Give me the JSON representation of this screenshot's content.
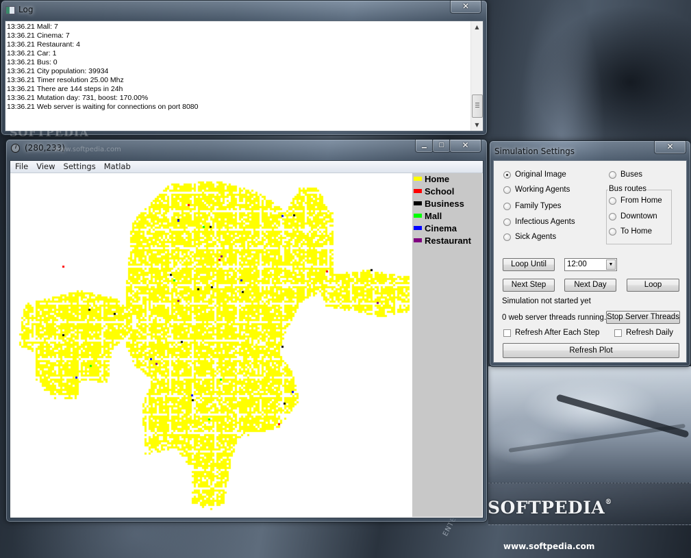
{
  "desktop": {
    "brand": "SOFTPEDIA",
    "brand_mark": "®",
    "url": "www.softpedia.com",
    "overlay_text": "ENTER",
    "watermark": "SOFTPEDIA",
    "watermark_url": "www.softpedia.com"
  },
  "log_window": {
    "title": "Log",
    "close_label": "✕",
    "lines": [
      {
        "time": "13:36.21",
        "text": "Mall: 7"
      },
      {
        "time": "13:36.21",
        "text": "Cinema: 7"
      },
      {
        "time": "13:36.21",
        "text": "Restaurant: 4"
      },
      {
        "time": "13:36.21",
        "text": "Car: 1"
      },
      {
        "time": "13:36.21",
        "text": "Bus: 0"
      },
      {
        "time": "13:36.21",
        "text": "City population: 39934"
      },
      {
        "time": "13:36.21",
        "text": "Timer resolution 25.00 Mhz"
      },
      {
        "time": "13:36.21",
        "text": "There are 144 steps in 24h"
      },
      {
        "time": "13:36.21",
        "text": "Mutation day: 731, boost: 170.00%"
      },
      {
        "time": "13:36.21",
        "text": "Web server is waiting for connections on port 8080"
      }
    ],
    "scroll_up": "▲",
    "scroll_down": "▼"
  },
  "map_window": {
    "title": "(280,233)",
    "minimize_label": "▁",
    "maximize_label": "▢",
    "close_label": "✕",
    "menu": [
      "File",
      "View",
      "Settings",
      "Matlab"
    ],
    "legend": [
      {
        "label": "Home",
        "color": "#ffff00"
      },
      {
        "label": "School",
        "color": "#ff0000"
      },
      {
        "label": "Business",
        "color": "#000000"
      },
      {
        "label": "Mall",
        "color": "#00ff00"
      },
      {
        "label": "Cinema",
        "color": "#0000ff"
      },
      {
        "label": "Restaurant",
        "color": "#800080"
      }
    ]
  },
  "settings_window": {
    "title": "Simulation Settings",
    "close_label": "✕",
    "view_options": [
      {
        "label": "Original Image",
        "checked": true
      },
      {
        "label": "Working Agents",
        "checked": false
      },
      {
        "label": "Family Types",
        "checked": false
      },
      {
        "label": "Infectious Agents",
        "checked": false
      },
      {
        "label": "Sick Agents",
        "checked": false
      }
    ],
    "buses_option": {
      "label": "Buses",
      "checked": false
    },
    "bus_routes": {
      "label": "Bus routes",
      "options": [
        {
          "label": "From Home",
          "checked": false
        },
        {
          "label": "Downtown",
          "checked": false
        },
        {
          "label": "To Home",
          "checked": false
        }
      ]
    },
    "loop_until_label": "Loop Until",
    "loop_until_value": "12:00",
    "next_step_label": "Next Step",
    "next_day_label": "Next Day",
    "loop_label": "Loop",
    "status_text": "Simulation not started yet",
    "threads_text": "0 web server threads running.",
    "stop_threads_label": "Stop Server Threads",
    "refresh_each_step": {
      "label": "Refresh After Each Step",
      "checked": false
    },
    "refresh_daily": {
      "label": "Refresh Daily",
      "checked": false
    },
    "refresh_plot_label": "Refresh Plot"
  }
}
